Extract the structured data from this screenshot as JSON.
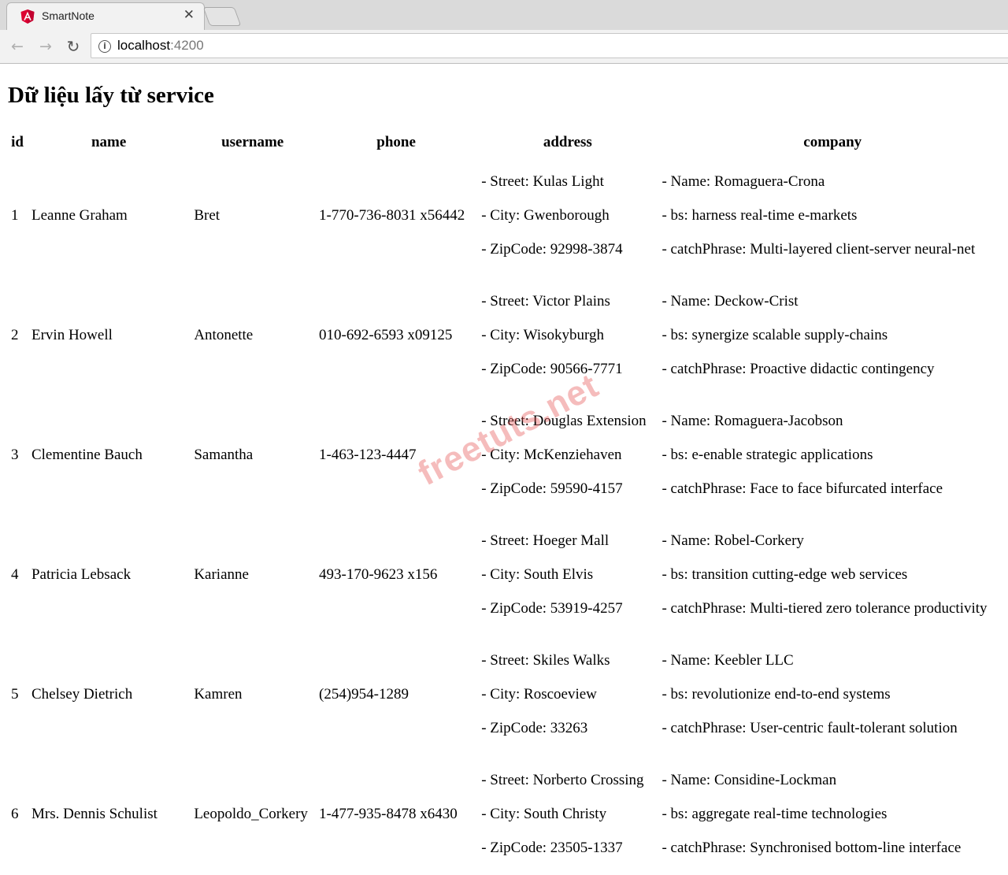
{
  "browser": {
    "tab_title": "SmartNote",
    "url_host": "localhost",
    "url_port": ":4200",
    "icons": {
      "back": "back-arrow-icon",
      "forward": "forward-arrow-icon",
      "reload": "reload-icon",
      "info": "info-icon",
      "close": "close-icon",
      "favicon": "angular-logo-icon"
    }
  },
  "page": {
    "heading": "Dữ liệu lấy từ service",
    "watermark": "freetuts.net",
    "columns": [
      "id",
      "name",
      "username",
      "phone",
      "address",
      "company"
    ],
    "rows": [
      {
        "id": "1",
        "name": "Leanne Graham",
        "username": "Bret",
        "phone": "1-770-736-8031 x56442",
        "address": [
          "- Street: Kulas Light",
          "- City: Gwenborough",
          "- ZipCode: 92998-3874"
        ],
        "company": [
          "- Name: Romaguera-Crona",
          "- bs: harness real-time e-markets",
          "- catchPhrase: Multi-layered client-server neural-net"
        ]
      },
      {
        "id": "2",
        "name": "Ervin Howell",
        "username": "Antonette",
        "phone": "010-692-6593 x09125",
        "address": [
          "- Street: Victor Plains",
          "- City: Wisokyburgh",
          "- ZipCode: 90566-7771"
        ],
        "company": [
          "- Name: Deckow-Crist",
          "- bs: synergize scalable supply-chains",
          "- catchPhrase: Proactive didactic contingency"
        ]
      },
      {
        "id": "3",
        "name": "Clementine Bauch",
        "username": "Samantha",
        "phone": "1-463-123-4447",
        "address": [
          "- Street: Douglas Extension",
          "- City: McKenziehaven",
          "- ZipCode: 59590-4157"
        ],
        "company": [
          "- Name: Romaguera-Jacobson",
          "- bs: e-enable strategic applications",
          "- catchPhrase: Face to face bifurcated interface"
        ]
      },
      {
        "id": "4",
        "name": "Patricia Lebsack",
        "username": "Karianne",
        "phone": "493-170-9623 x156",
        "address": [
          "- Street: Hoeger Mall",
          "- City: South Elvis",
          "- ZipCode: 53919-4257"
        ],
        "company": [
          "- Name: Robel-Corkery",
          "- bs: transition cutting-edge web services",
          "- catchPhrase: Multi-tiered zero tolerance productivity"
        ]
      },
      {
        "id": "5",
        "name": "Chelsey Dietrich",
        "username": "Kamren",
        "phone": "(254)954-1289",
        "address": [
          "- Street: Skiles Walks",
          "- City: Roscoeview",
          "- ZipCode: 33263"
        ],
        "company": [
          "- Name: Keebler LLC",
          "- bs: revolutionize end-to-end systems",
          "- catchPhrase: User-centric fault-tolerant solution"
        ]
      },
      {
        "id": "6",
        "name": "Mrs. Dennis Schulist",
        "username": "Leopoldo_Corkery",
        "phone": "1-477-935-8478 x6430",
        "address": [
          "- Street: Norberto Crossing",
          "- City: South Christy",
          "- ZipCode: 23505-1337"
        ],
        "company": [
          "- Name: Considine-Lockman",
          "- bs: aggregate real-time technologies",
          "- catchPhrase: Synchronised bottom-line interface"
        ]
      }
    ]
  }
}
